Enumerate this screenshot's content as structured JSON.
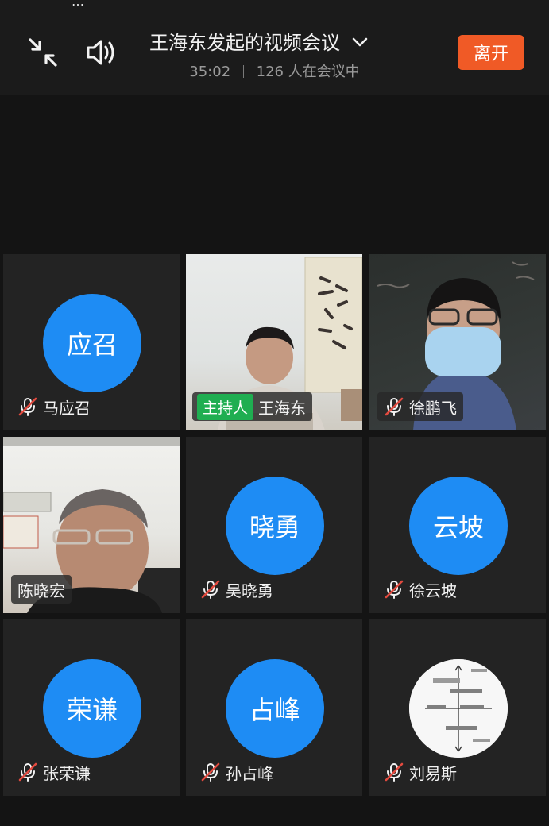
{
  "top_fragment": "…",
  "header": {
    "title": "王海东发起的视频会议",
    "duration": "35:02",
    "participants": "126 人在会议中",
    "leave_label": "离开"
  },
  "colors": {
    "accent_orange": "#f05a26",
    "avatar_blue": "#1e8cf4",
    "host_green": "#1fae51",
    "mute_red": "#e24a3f"
  },
  "participants": [
    {
      "name": "马应召",
      "avatar": "应召",
      "muted": true
    },
    {
      "name": "王海东",
      "host_label": "主持人",
      "muted": false
    },
    {
      "name": "徐鹏飞",
      "muted": true
    },
    {
      "name": "陈晓宏",
      "muted": false
    },
    {
      "name": "吴晓勇",
      "avatar": "晓勇",
      "muted": true
    },
    {
      "name": "徐云坡",
      "avatar": "云坡",
      "muted": true
    },
    {
      "name": "张荣谦",
      "avatar": "荣谦",
      "muted": true
    },
    {
      "name": "孙占峰",
      "avatar": "占峰",
      "muted": true
    },
    {
      "name": "刘易斯",
      "muted": true
    }
  ],
  "icons": {
    "collapse": "collapse-arrows-icon",
    "speaker": "speaker-icon",
    "dropdown": "chevron-down-icon",
    "mute": "mic-muted-icon"
  }
}
